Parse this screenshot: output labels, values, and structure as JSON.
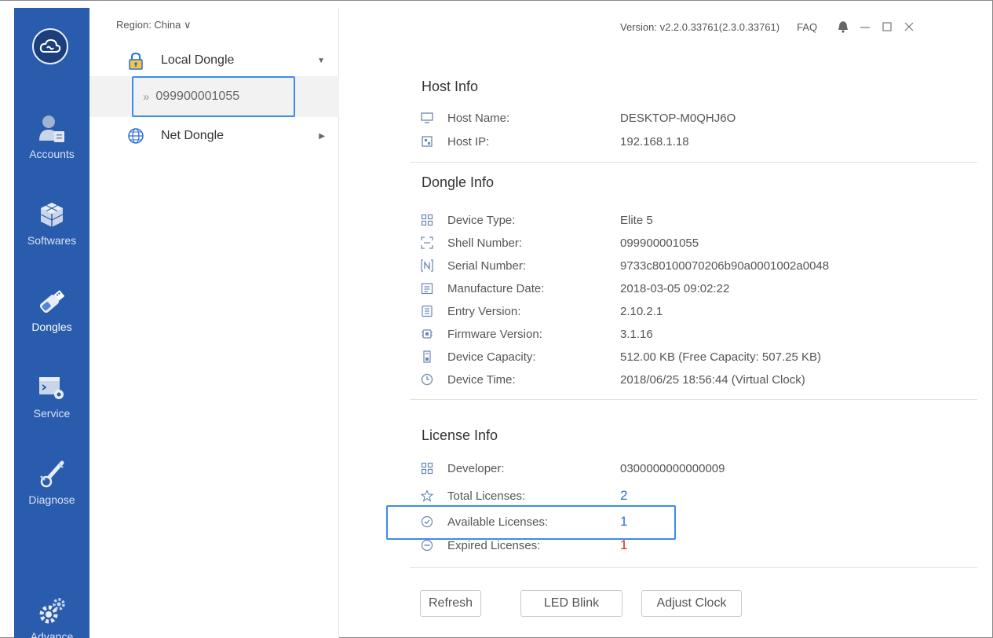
{
  "sidebar": {
    "items": [
      {
        "label": "Accounts",
        "icon": "accounts-icon"
      },
      {
        "label": "Softwares",
        "icon": "softwares-icon"
      },
      {
        "label": "Dongles",
        "icon": "dongles-icon"
      },
      {
        "label": "Service",
        "icon": "service-icon"
      },
      {
        "label": "Diagnose",
        "icon": "diagnose-icon"
      },
      {
        "label": "Advance",
        "icon": "advance-icon"
      }
    ],
    "active": "Dongles"
  },
  "tree": {
    "region": "Region: China ∨",
    "local_dongle": "Local Dongle",
    "selected_dongle": "099900001055",
    "net_dongle": "Net Dongle"
  },
  "topbar": {
    "version": "Version: v2.2.0.33761(2.3.0.33761)",
    "faq": "FAQ"
  },
  "host_info": {
    "title": "Host Info",
    "rows": [
      {
        "label": "Host Name:",
        "value": "DESKTOP-M0QHJ6O",
        "icon": "monitor-icon"
      },
      {
        "label": "Host IP:",
        "value": "192.168.1.18",
        "icon": "network-icon"
      }
    ]
  },
  "dongle_info": {
    "title": "Dongle Info",
    "rows": [
      {
        "label": "Device Type:",
        "value": "Elite 5",
        "icon": "grid-icon"
      },
      {
        "label": "Shell Number:",
        "value": "099900001055",
        "icon": "shell-icon"
      },
      {
        "label": "Serial Number:",
        "value": "9733c80100070206b90a0001002a0048",
        "icon": "serial-icon"
      },
      {
        "label": "Manufacture Date:",
        "value": "2018-03-05 09:02:22",
        "icon": "calendar-icon"
      },
      {
        "label": "Entry Version:",
        "value": "2.10.2.1",
        "icon": "document-icon"
      },
      {
        "label": "Firmware Version:",
        "value": "3.1.16",
        "icon": "chip-icon"
      },
      {
        "label": "Device Capacity:",
        "value": "512.00 KB (Free Capacity: 507.25 KB)",
        "icon": "storage-icon"
      },
      {
        "label": "Device Time:",
        "value": "2018/06/25 18:56:44 (Virtual Clock)",
        "icon": "clock-icon"
      }
    ]
  },
  "license_info": {
    "title": "License Info",
    "rows": [
      {
        "label": "Developer:",
        "value": "0300000000000009",
        "icon": "grid-icon"
      },
      {
        "label": "Total Licenses:",
        "value": "2",
        "icon": "star-icon"
      },
      {
        "label": "Available Licenses:",
        "value": "1",
        "icon": "check-circle-icon"
      },
      {
        "label": "Expired Licenses:",
        "value": "1",
        "icon": "minus-circle-icon"
      }
    ]
  },
  "buttons": {
    "refresh": "Refresh",
    "led_blink": "LED Blink",
    "adjust_clock": "Adjust Clock"
  },
  "colors": {
    "sidebar": "#2a5cae",
    "accent": "#3a8ee6",
    "value_blue": "#2a6fd6",
    "value_red": "#e02020"
  }
}
